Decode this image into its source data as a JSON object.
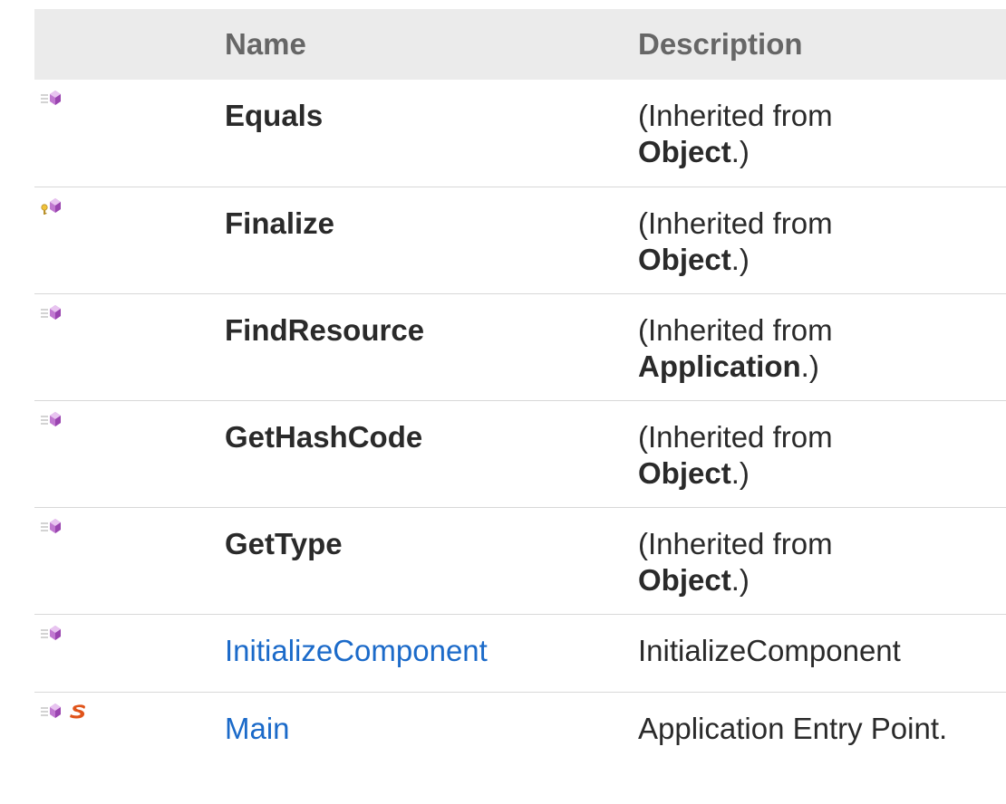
{
  "table": {
    "header": {
      "name": "Name",
      "description": "Description"
    },
    "rows": [
      {
        "name": "Equals",
        "is_link": false,
        "desc_prefix": "(Inherited from",
        "desc_bold": "Object",
        "desc_suffix": ".)",
        "icons": [
          "public-method-icon"
        ]
      },
      {
        "name": "Finalize",
        "is_link": false,
        "desc_prefix": "(Inherited from",
        "desc_bold": "Object",
        "desc_suffix": ".)",
        "icons": [
          "protected-method-icon"
        ]
      },
      {
        "name": "FindResource",
        "is_link": false,
        "desc_prefix": "(Inherited from",
        "desc_bold": "Application",
        "desc_suffix": ".)",
        "icons": [
          "public-method-icon"
        ]
      },
      {
        "name": "GetHashCode",
        "is_link": false,
        "desc_prefix": "(Inherited from",
        "desc_bold": "Object",
        "desc_suffix": ".)",
        "icons": [
          "public-method-icon"
        ]
      },
      {
        "name": "GetType",
        "is_link": false,
        "desc_prefix": "(Inherited from",
        "desc_bold": "Object",
        "desc_suffix": ".)",
        "icons": [
          "public-method-icon"
        ]
      },
      {
        "name": "InitializeComponent",
        "is_link": true,
        "description": "InitializeComponent",
        "icons": [
          "public-method-icon"
        ]
      },
      {
        "name": "Main",
        "is_link": true,
        "description": "Application Entry Point.",
        "icons": [
          "public-method-icon",
          "static-member-icon"
        ]
      }
    ]
  },
  "colors": {
    "header_bg": "#ebebeb",
    "header_text": "#666666",
    "link": "#1b6ac9",
    "text": "#2a2a2a",
    "method_icon": "#b455c8",
    "static_icon": "#e0541a"
  }
}
